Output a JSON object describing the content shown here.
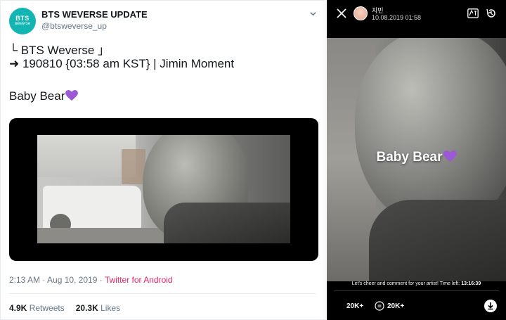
{
  "tweet": {
    "account": {
      "name": "BTS WEVERSE UPDATE",
      "handle": "@btsweverse_up",
      "avatar_text": "BTS",
      "avatar_subtext": "weverse",
      "avatar_color": "#12b5b2"
    },
    "lines": [
      "└ BTS Weverse 」",
      "➜ 190810 {03:58 am KST} | Jimin Moment",
      "Baby Bear"
    ],
    "heart_icon": "purple-heart-icon",
    "timestamp": "2:13 AM · Aug 10, 2019 · ",
    "source": "Twitter for Android",
    "retweets_count": "4.9K",
    "retweets_label": "Retweets",
    "likes_count": "20.3K",
    "likes_label": "Likes"
  },
  "weverse_post": {
    "author": "지민",
    "date": "10.08.2019 01:58",
    "caption": "Baby Bear",
    "cheer_text": "Let's cheer and comment for your artist! Time left: ",
    "time_left": "13:16:39",
    "likes": "20K+",
    "comments": "20K+",
    "icons": [
      "close-icon",
      "translate-icon",
      "history-icon",
      "comment-icon",
      "download-icon"
    ]
  },
  "colors": {
    "twitter_source": "#e0245e",
    "heart": "#9b59d6",
    "text_secondary": "#657786"
  }
}
